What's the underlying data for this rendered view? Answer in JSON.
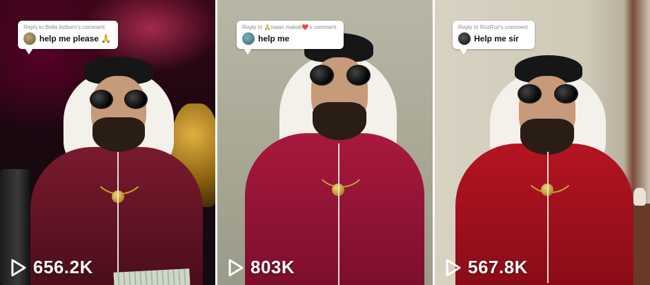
{
  "videos": [
    {
      "reply_label": "Reply to Bella listborn's comment",
      "comment": "help me please 🙏",
      "views": "656.2K",
      "avatar_color": "#8a7a5a",
      "robe_color": "#7a1a2e"
    },
    {
      "reply_label": "Reply to 🙏isaan makali❤️'s comment",
      "comment": "help me",
      "views": "803K",
      "avatar_color": "#3f6f7a",
      "robe_color": "#a8193d"
    },
    {
      "reply_label": "Reply to RozRoz's comment",
      "comment": "Help me sir",
      "views": "567.8K",
      "avatar_color": "#1e1e1e",
      "robe_color": "#b51422"
    }
  ],
  "icons": {
    "play": "play-icon"
  }
}
